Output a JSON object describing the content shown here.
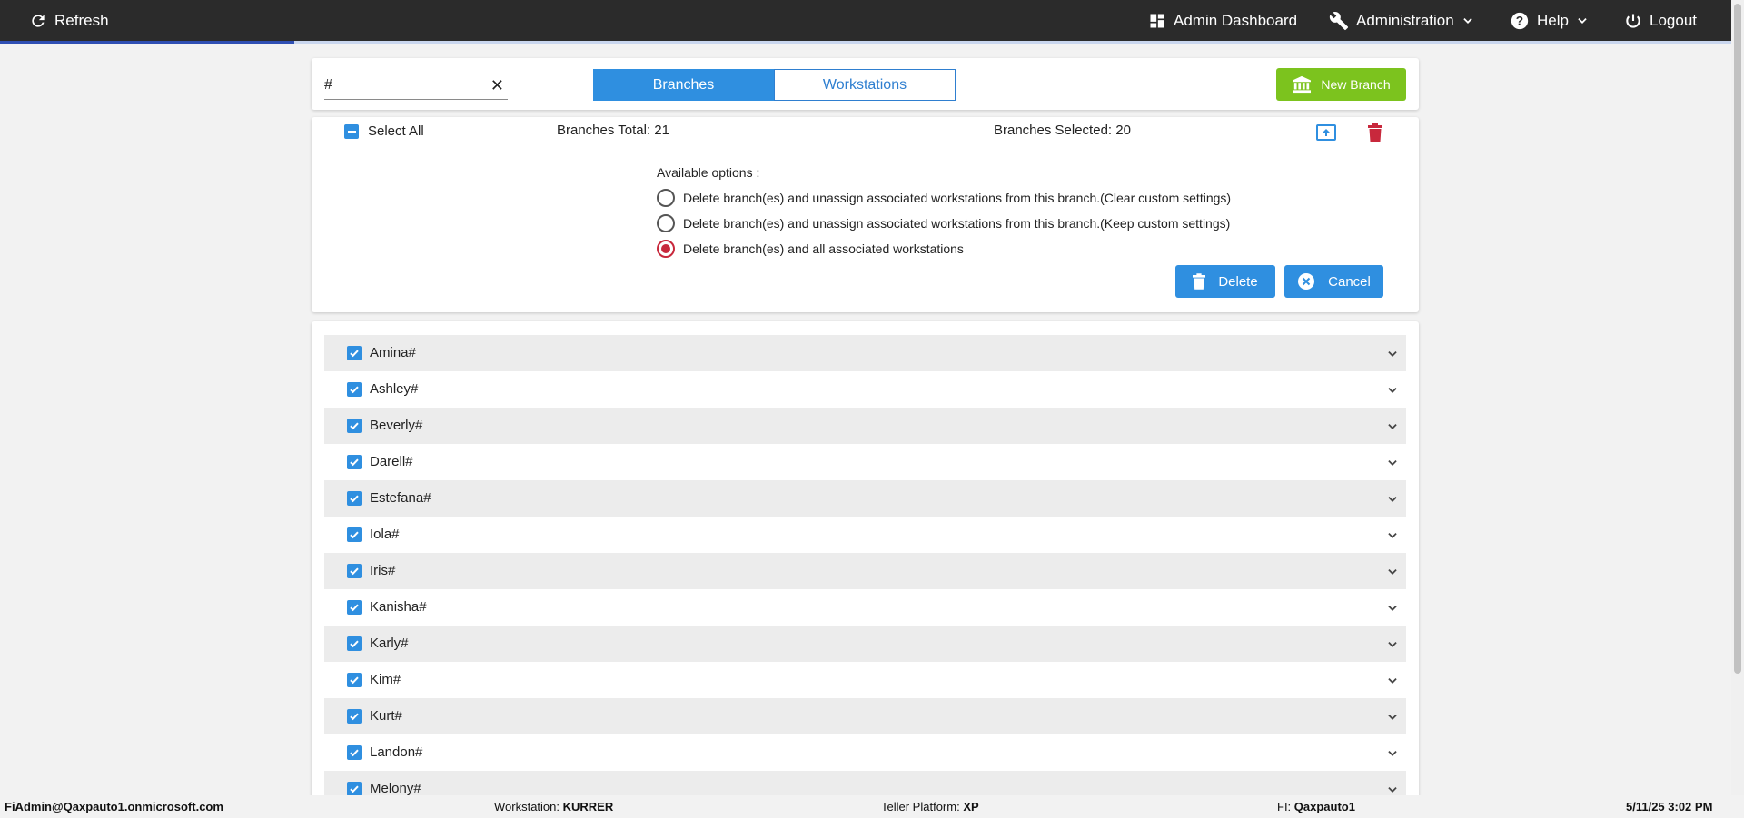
{
  "topbar": {
    "refresh_label": "Refresh",
    "admin_dashboard_label": "Admin Dashboard",
    "administration_label": "Administration",
    "help_label": "Help",
    "logout_label": "Logout",
    "progress_fraction": 0.17
  },
  "toolbar": {
    "search_value": "#",
    "search_clear": "✕",
    "tab_branches": "Branches",
    "tab_workstations": "Workstations",
    "active_tab": "Branches",
    "new_branch_label": "New Branch"
  },
  "selection": {
    "select_all_label": "Select All",
    "branches_total": "Branches Total: 21",
    "branches_selected": "Branches Selected: 20"
  },
  "delete_panel": {
    "available_options_label": "Available options :",
    "options": [
      {
        "label": "Delete branch(es) and unassign associated workstations from this branch.(Clear custom settings)",
        "selected": false
      },
      {
        "label": "Delete branch(es) and unassign associated workstations from this branch.(Keep custom settings)",
        "selected": false
      },
      {
        "label": "Delete branch(es) and all associated workstations",
        "selected": true
      }
    ],
    "delete_label": "Delete",
    "cancel_label": "Cancel"
  },
  "branches": [
    {
      "name": "Amina#",
      "checked": true
    },
    {
      "name": "Ashley#",
      "checked": true
    },
    {
      "name": "Beverly#",
      "checked": true
    },
    {
      "name": "Darell#",
      "checked": true
    },
    {
      "name": "Estefana#",
      "checked": true
    },
    {
      "name": "Iola#",
      "checked": true
    },
    {
      "name": "Iris#",
      "checked": true
    },
    {
      "name": "Kanisha#",
      "checked": true
    },
    {
      "name": "Karly#",
      "checked": true
    },
    {
      "name": "Kim#",
      "checked": true
    },
    {
      "name": "Kurt#",
      "checked": true
    },
    {
      "name": "Landon#",
      "checked": true
    },
    {
      "name": "Melony#",
      "checked": true
    }
  ],
  "statusbar": {
    "user": "FiAdmin@Qaxpauto1.onmicrosoft.com",
    "workstation_label": "Workstation:",
    "workstation_value": "KURRER",
    "teller_label": "Teller Platform:",
    "teller_value": "XP",
    "fi_label": "FI:",
    "fi_value": "Qaxpauto1",
    "datetime": "5/11/25 3:02 PM"
  },
  "colors": {
    "accent_blue": "#2f8fe0",
    "new_branch_green": "#7cc31e",
    "delete_red": "#c8283c",
    "topbar_bg": "#2b2b2b"
  }
}
